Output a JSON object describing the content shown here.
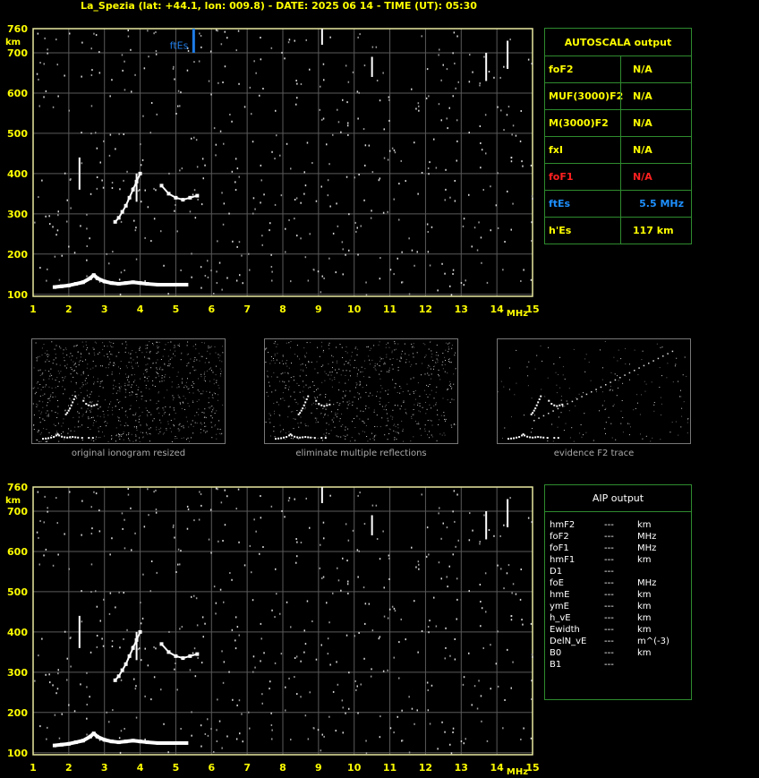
{
  "title": "La_Spezia (lat: +44.1, lon: 009.8) - DATE: 2025 06 14 - TIME (UT): 05:30",
  "colors": {
    "frame": "#e8e8a0",
    "grid": "#5a5a5a",
    "label": "#ffff00",
    "accent_blue": "#1e7be6",
    "table_border": "#2e8b2e",
    "red": "#ff2020"
  },
  "chart_data": [
    {
      "type": "scatter",
      "panel": "top-ionogram",
      "xlabel": "MHz",
      "ylabel": "km",
      "xlim": [
        1,
        15
      ],
      "ylim": [
        95,
        760
      ],
      "x_ticks": [
        "1",
        "2",
        "3",
        "4",
        "5",
        "6",
        "7",
        "8",
        "9",
        "10",
        "11",
        "12",
        "13",
        "14",
        "15"
      ],
      "y_ticks": [
        "100",
        "200",
        "300",
        "400",
        "500",
        "600",
        "700",
        "760"
      ],
      "grid": true,
      "annotation": {
        "text": "ftEs",
        "x": 5.5
      },
      "series": [
        {
          "values": [
            [
              1.6,
              118
            ],
            [
              1.8,
              120
            ],
            [
              2.0,
              122
            ],
            [
              2.2,
              126
            ],
            [
              2.4,
              130
            ],
            [
              2.6,
              140
            ],
            [
              2.7,
              148
            ],
            [
              2.8,
              140
            ],
            [
              3.0,
              132
            ],
            [
              3.2,
              128
            ],
            [
              3.4,
              126
            ],
            [
              3.6,
              128
            ],
            [
              3.8,
              130
            ],
            [
              4.0,
              128
            ],
            [
              4.2,
              126
            ],
            [
              4.5,
              124
            ],
            [
              5.0,
              124
            ],
            [
              5.3,
              124
            ]
          ]
        },
        {
          "values": [
            [
              3.3,
              280
            ],
            [
              3.4,
              290
            ],
            [
              3.5,
              305
            ],
            [
              3.6,
              320
            ],
            [
              3.7,
              340
            ],
            [
              3.8,
              360
            ],
            [
              3.9,
              380
            ],
            [
              4.0,
              400
            ]
          ]
        },
        {
          "values": [
            [
              4.6,
              370
            ],
            [
              4.8,
              350
            ],
            [
              5.0,
              340
            ],
            [
              5.2,
              335
            ],
            [
              5.4,
              340
            ],
            [
              5.6,
              345
            ]
          ]
        }
      ]
    },
    {
      "type": "scatter",
      "panel": "bottom-ionogram",
      "xlabel": "MHz",
      "ylabel": "km",
      "xlim": [
        1,
        15
      ],
      "ylim": [
        95,
        760
      ],
      "x_ticks": [
        "1",
        "2",
        "3",
        "4",
        "5",
        "6",
        "7",
        "8",
        "9",
        "10",
        "11",
        "12",
        "13",
        "14",
        "15"
      ],
      "y_ticks": [
        "100",
        "200",
        "300",
        "400",
        "500",
        "600",
        "700",
        "760"
      ],
      "grid": true,
      "series": [
        {
          "values": [
            [
              1.6,
              118
            ],
            [
              1.8,
              120
            ],
            [
              2.0,
              122
            ],
            [
              2.2,
              126
            ],
            [
              2.4,
              130
            ],
            [
              2.6,
              140
            ],
            [
              2.7,
              148
            ],
            [
              2.8,
              140
            ],
            [
              3.0,
              132
            ],
            [
              3.2,
              128
            ],
            [
              3.4,
              126
            ],
            [
              3.6,
              128
            ],
            [
              3.8,
              130
            ],
            [
              4.0,
              128
            ],
            [
              4.2,
              126
            ],
            [
              4.5,
              124
            ],
            [
              5.0,
              124
            ],
            [
              5.3,
              124
            ]
          ]
        },
        {
          "values": [
            [
              3.3,
              280
            ],
            [
              3.4,
              290
            ],
            [
              3.5,
              305
            ],
            [
              3.6,
              320
            ],
            [
              3.7,
              340
            ],
            [
              3.8,
              360
            ],
            [
              3.9,
              380
            ],
            [
              4.0,
              400
            ]
          ]
        },
        {
          "values": [
            [
              4.6,
              370
            ],
            [
              4.8,
              350
            ],
            [
              5.0,
              340
            ],
            [
              5.2,
              335
            ],
            [
              5.4,
              340
            ],
            [
              5.6,
              345
            ]
          ]
        }
      ]
    }
  ],
  "autoscala": {
    "header": "AUTOSCALA output",
    "rows": [
      {
        "label": "foF2",
        "value": "N/A",
        "color": "#ffff00"
      },
      {
        "label": "MUF(3000)F2",
        "value": "N/A",
        "color": "#ffff00"
      },
      {
        "label": "M(3000)F2",
        "value": "N/A",
        "color": "#ffff00"
      },
      {
        "label": "fxI",
        "value": "N/A",
        "color": "#ffff00"
      },
      {
        "label": "foF1",
        "value": "N/A",
        "color": "#ff2020"
      },
      {
        "label": "ftEs",
        "value": "5.5 MHz",
        "color": "#1e90ff"
      },
      {
        "label": "h'Es",
        "value": "117     km",
        "color": "#ffff00"
      }
    ]
  },
  "thumbnails": [
    {
      "caption": "original ionogram resized"
    },
    {
      "caption": "eliminate multiple reflections"
    },
    {
      "caption": "evidence F2 trace"
    }
  ],
  "aip": {
    "header": "AIP output",
    "rows": [
      {
        "label": "hmF2",
        "value": "---",
        "unit": "km"
      },
      {
        "label": "foF2",
        "value": "---",
        "unit": "MHz"
      },
      {
        "label": "foF1",
        "value": "---",
        "unit": "MHz"
      },
      {
        "label": "hmF1",
        "value": "---",
        "unit": "km"
      },
      {
        "label": "D1",
        "value": "---",
        "unit": ""
      },
      {
        "label": "foE",
        "value": "---",
        "unit": "MHz"
      },
      {
        "label": "hmE",
        "value": "---",
        "unit": "km"
      },
      {
        "label": "ymE",
        "value": "---",
        "unit": "km"
      },
      {
        "label": "h_vE",
        "value": "---",
        "unit": "km"
      },
      {
        "label": "Ewidth",
        "value": "---",
        "unit": "km"
      },
      {
        "label": "DelN_vE",
        "value": "---",
        "unit": "m^(-3)"
      },
      {
        "label": "B0",
        "value": "---",
        "unit": "km"
      },
      {
        "label": "B1",
        "value": "---",
        "unit": ""
      }
    ]
  }
}
